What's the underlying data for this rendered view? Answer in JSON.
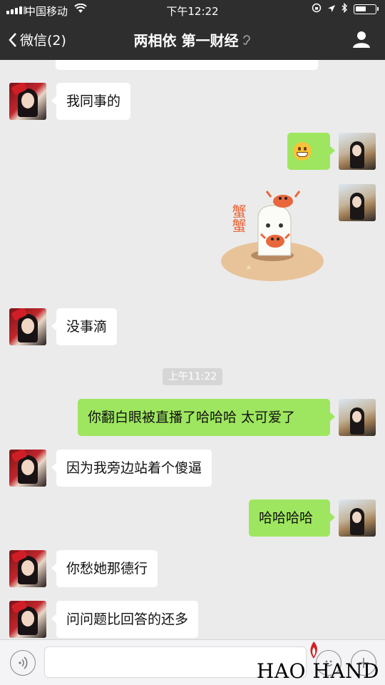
{
  "status_bar": {
    "carrier": "中国移动",
    "time": "下午12:22"
  },
  "nav": {
    "back_label": "微信(2)",
    "title": "两相依 第一财经"
  },
  "chat": {
    "messages": [
      {
        "side": "in",
        "text": "我同事的"
      },
      {
        "side": "out",
        "type": "emoji",
        "emoji": "grinning-face"
      },
      {
        "side": "out",
        "type": "sticker",
        "sticker_text": "蟹蟹"
      },
      {
        "side": "in",
        "text": "没事滴"
      },
      {
        "side": "out",
        "text": "你翻白眼被直播了哈哈哈 太可爱了"
      },
      {
        "side": "in",
        "text": "因为我旁边站着个傻逼"
      },
      {
        "side": "out",
        "text": "哈哈哈哈"
      },
      {
        "side": "in",
        "text": "你愁她那德行"
      },
      {
        "side": "in",
        "text": "问问题比回答的还多"
      }
    ],
    "timestamp": "上午11:22"
  },
  "watermark": "HAO HAND",
  "colors": {
    "bar": "#2e2e2e",
    "sent_bubble": "#9ee65f",
    "received_bubble": "#ffffff",
    "background": "#ebebeb"
  }
}
